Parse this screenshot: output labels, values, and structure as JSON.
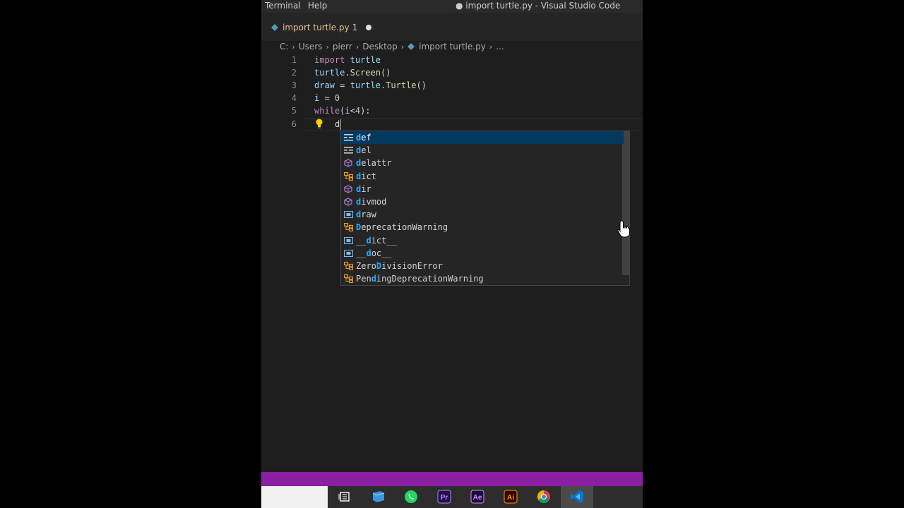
{
  "titlebar": {
    "menu": [
      "Terminal",
      "Help"
    ],
    "window_title": "● import turtle.py - Visual Studio Code"
  },
  "tab": {
    "label": "import turtle.py",
    "badge": "1"
  },
  "breadcrumb": [
    "C:",
    "Users",
    "pierr",
    "Desktop",
    "import turtle.py",
    "..."
  ],
  "editor": {
    "lines": [
      {
        "num": "1",
        "tokens": [
          [
            "kw",
            "import"
          ],
          [
            "op",
            " "
          ],
          [
            "ident",
            "turtle"
          ]
        ]
      },
      {
        "num": "2",
        "tokens": [
          [
            "ident",
            "turtle"
          ],
          [
            "op",
            "."
          ],
          [
            "fn",
            "Screen"
          ],
          [
            "op",
            "()"
          ]
        ]
      },
      {
        "num": "3",
        "tokens": [
          [
            "ident",
            "draw"
          ],
          [
            "op",
            " = "
          ],
          [
            "ident",
            "turtle"
          ],
          [
            "op",
            "."
          ],
          [
            "fn",
            "Turtle"
          ],
          [
            "op",
            "()"
          ]
        ]
      },
      {
        "num": "4",
        "tokens": [
          [
            "ident",
            "i"
          ],
          [
            "op",
            " = "
          ],
          [
            "num",
            "0"
          ]
        ]
      },
      {
        "num": "5",
        "tokens": [
          [
            "kw",
            "while"
          ],
          [
            "op",
            "("
          ],
          [
            "ident",
            "i"
          ],
          [
            "op",
            "<"
          ],
          [
            "num",
            "4"
          ],
          [
            "op",
            "):"
          ]
        ]
      },
      {
        "num": "6",
        "tokens": []
      }
    ],
    "typed": "d"
  },
  "suggestions": [
    {
      "label": "def",
      "kind": "keyword"
    },
    {
      "label": "del",
      "kind": "keyword"
    },
    {
      "label": "delattr",
      "kind": "method"
    },
    {
      "label": "dict",
      "kind": "class"
    },
    {
      "label": "dir",
      "kind": "method"
    },
    {
      "label": "divmod",
      "kind": "method"
    },
    {
      "label": "draw",
      "kind": "variable"
    },
    {
      "label": "DeprecationWarning",
      "kind": "class"
    },
    {
      "label": "__dict__",
      "kind": "variable"
    },
    {
      "label": "__doc__",
      "kind": "variable"
    },
    {
      "label": "ZeroDivisionError",
      "kind": "class"
    },
    {
      "label": "PendingDeprecationWarning",
      "kind": "class"
    }
  ],
  "taskbar": {
    "apps": [
      "task-view",
      "files",
      "whatsapp",
      "premiere-pro",
      "after-effects",
      "illustrator",
      "chrome",
      "vscode"
    ]
  },
  "colors": {
    "accent_purple": "#8a1fa3",
    "selection": "#04395e",
    "match_highlight": "#2aaaff"
  }
}
